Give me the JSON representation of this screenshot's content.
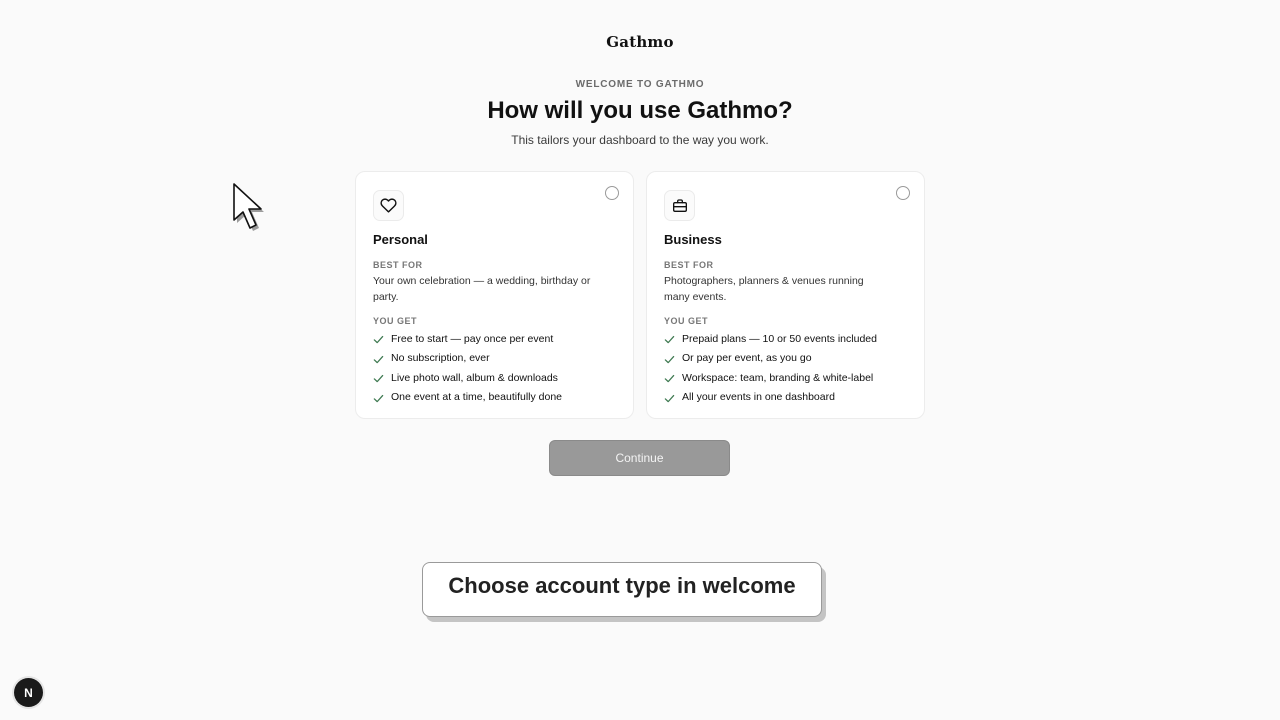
{
  "header": {
    "logo": "Gathmo",
    "eyebrow": "WELCOME TO GATHMO",
    "title": "How will you use Gathmo?",
    "subtitle": "This tailors your dashboard to the way you work."
  },
  "cards": [
    {
      "id": "personal",
      "icon": "heart-icon",
      "title": "Personal",
      "best_for_label": "BEST FOR",
      "best_for": "Your own celebration — a wedding, birthday or party.",
      "you_get_label": "YOU GET",
      "features": [
        "Free to start — pay once per event",
        "No subscription, ever",
        "Live photo wall, album & downloads",
        "One event at a time, beautifully done"
      ],
      "selected": false
    },
    {
      "id": "business",
      "icon": "briefcase-icon",
      "title": "Business",
      "best_for_label": "BEST FOR",
      "best_for": "Photographers, planners & venues running many events.",
      "you_get_label": "YOU GET",
      "features": [
        "Prepaid plans — 10 or 50 events included",
        "Or pay per event, as you go",
        "Workspace: team, branding & white-label",
        "All your events in one dashboard"
      ],
      "selected": false
    }
  ],
  "continue_label": "Continue",
  "caption": "Choose account type in welcome",
  "dev_badge": "N",
  "colors": {
    "background": "#fafafa",
    "check": "#3f7a52",
    "button_disabled": "#999999"
  }
}
